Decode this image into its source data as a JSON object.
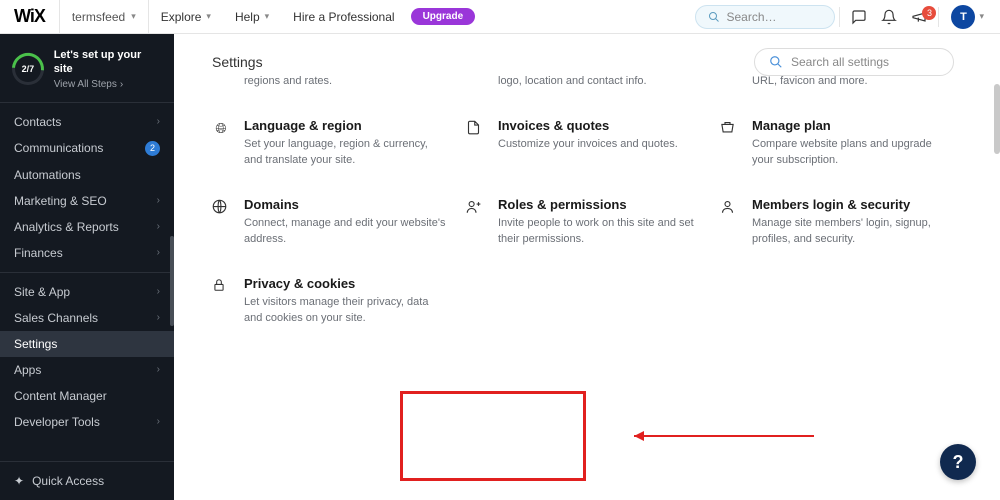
{
  "top": {
    "logo": "WiX",
    "site": "termsfeed",
    "links": {
      "explore": "Explore",
      "help": "Help",
      "hire": "Hire a Professional"
    },
    "upgrade": "Upgrade",
    "search_placeholder": "Search…",
    "notif_badge": "3",
    "avatar_initial": "T"
  },
  "setup": {
    "progress": "2/7",
    "title": "Let's set up your site",
    "sub": "View All Steps"
  },
  "nav": {
    "g1": [
      {
        "label": "Contacts",
        "chev": true
      },
      {
        "label": "Communications",
        "chev": false,
        "badge": "2"
      },
      {
        "label": "Automations",
        "chev": false
      },
      {
        "label": "Marketing & SEO",
        "chev": true
      },
      {
        "label": "Analytics & Reports",
        "chev": true
      },
      {
        "label": "Finances",
        "chev": true
      }
    ],
    "g2": [
      {
        "label": "Site & App",
        "chev": true
      },
      {
        "label": "Sales Channels",
        "chev": true
      },
      {
        "label": "Settings",
        "chev": false,
        "active": true
      },
      {
        "label": "Apps",
        "chev": true
      },
      {
        "label": "Content Manager",
        "chev": false
      },
      {
        "label": "Developer Tools",
        "chev": true
      }
    ],
    "quick": "Quick Access"
  },
  "page": {
    "title": "Settings",
    "search_placeholder": "Search all settings"
  },
  "cards": {
    "partial_row": [
      {
        "desc": "regions and rates."
      },
      {
        "desc": "logo, location and contact info."
      },
      {
        "desc": "URL, favicon and more."
      }
    ],
    "row2": [
      {
        "icon": "globe",
        "title": "Language & region",
        "desc": "Set your language, region & currency, and translate your site."
      },
      {
        "icon": "invoice",
        "title": "Invoices & quotes",
        "desc": "Customize your invoices and quotes."
      },
      {
        "icon": "plan",
        "title": "Manage plan",
        "desc": "Compare website plans and upgrade your subscription."
      }
    ],
    "row3": [
      {
        "icon": "domain",
        "title": "Domains",
        "desc": "Connect, manage and edit your website's address."
      },
      {
        "icon": "roles",
        "title": "Roles & permissions",
        "desc": "Invite people to work on this site and set their permissions."
      },
      {
        "icon": "members",
        "title": "Members login & security",
        "desc": "Manage site members' login, signup, profiles, and security."
      }
    ],
    "row4": [
      {
        "icon": "lock",
        "title": "Privacy & cookies",
        "desc": "Let visitors manage their privacy, data and cookies on your site."
      }
    ]
  }
}
